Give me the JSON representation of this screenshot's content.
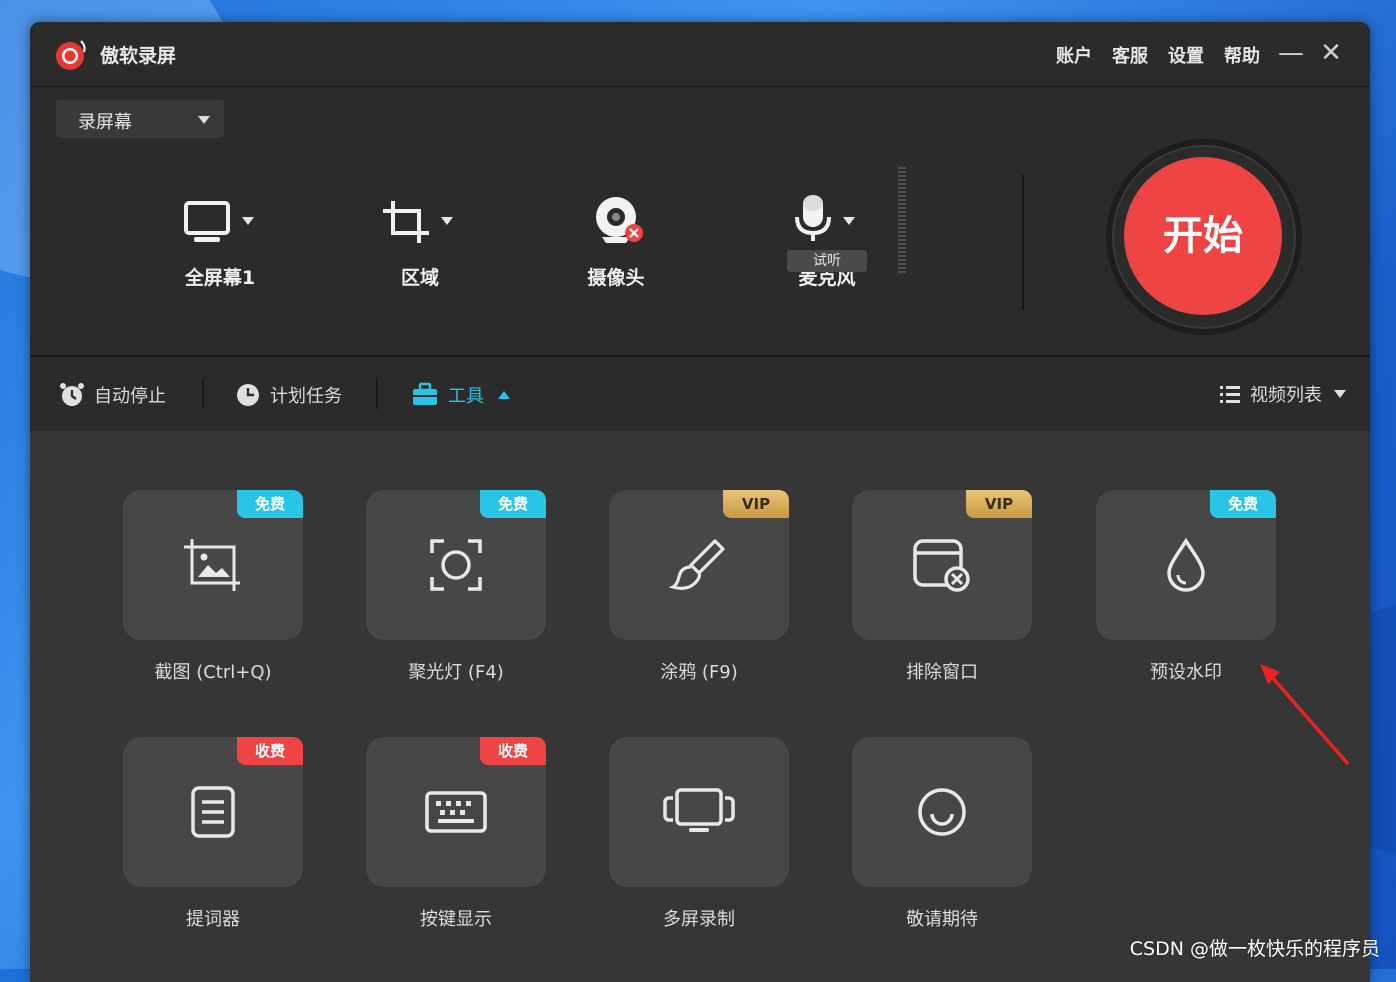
{
  "app": {
    "title": "傲软录屏"
  },
  "topmenu": [
    "账户",
    "客服",
    "设置",
    "帮助"
  ],
  "window": {
    "minimize": "—",
    "close": "✕"
  },
  "mode": {
    "selected": "录屏幕"
  },
  "sources": {
    "screen": "全屏幕1",
    "region": "区域",
    "camera": "摄像头",
    "mic": "麦克风",
    "mic_test": "试听"
  },
  "start_button": "开始",
  "toolbar": {
    "auto_stop": "自动停止",
    "schedule": "计划任务",
    "tools": "工具",
    "video_list": "视频列表"
  },
  "tools": [
    {
      "label": "截图 (Ctrl+Q)",
      "badge": "免费",
      "badge_type": "free",
      "icon": "screenshot-icon"
    },
    {
      "label": "聚光灯 (F4)",
      "badge": "免费",
      "badge_type": "free",
      "icon": "spotlight-icon"
    },
    {
      "label": "涂鸦 (F9)",
      "badge": "VIP",
      "badge_type": "vip",
      "icon": "brush-icon"
    },
    {
      "label": "排除窗口",
      "badge": "VIP",
      "badge_type": "vip",
      "icon": "exclude-window-icon"
    },
    {
      "label": "预设水印",
      "badge": "免费",
      "badge_type": "free",
      "icon": "watermark-drop-icon"
    },
    {
      "label": "提词器",
      "badge": "收费",
      "badge_type": "paid",
      "icon": "teleprompter-icon"
    },
    {
      "label": "按键显示",
      "badge": "收费",
      "badge_type": "paid",
      "icon": "keyboard-icon"
    },
    {
      "label": "多屏录制",
      "badge": "",
      "badge_type": "",
      "icon": "multi-screen-icon"
    },
    {
      "label": "敬请期待",
      "badge": "",
      "badge_type": "",
      "icon": "coming-soon-icon"
    }
  ],
  "colors": {
    "accent": "#29c4e6",
    "record": "#ee4444",
    "vip": "#d9ad5a"
  },
  "watermark": "CSDN @做一枚快乐的程序员"
}
